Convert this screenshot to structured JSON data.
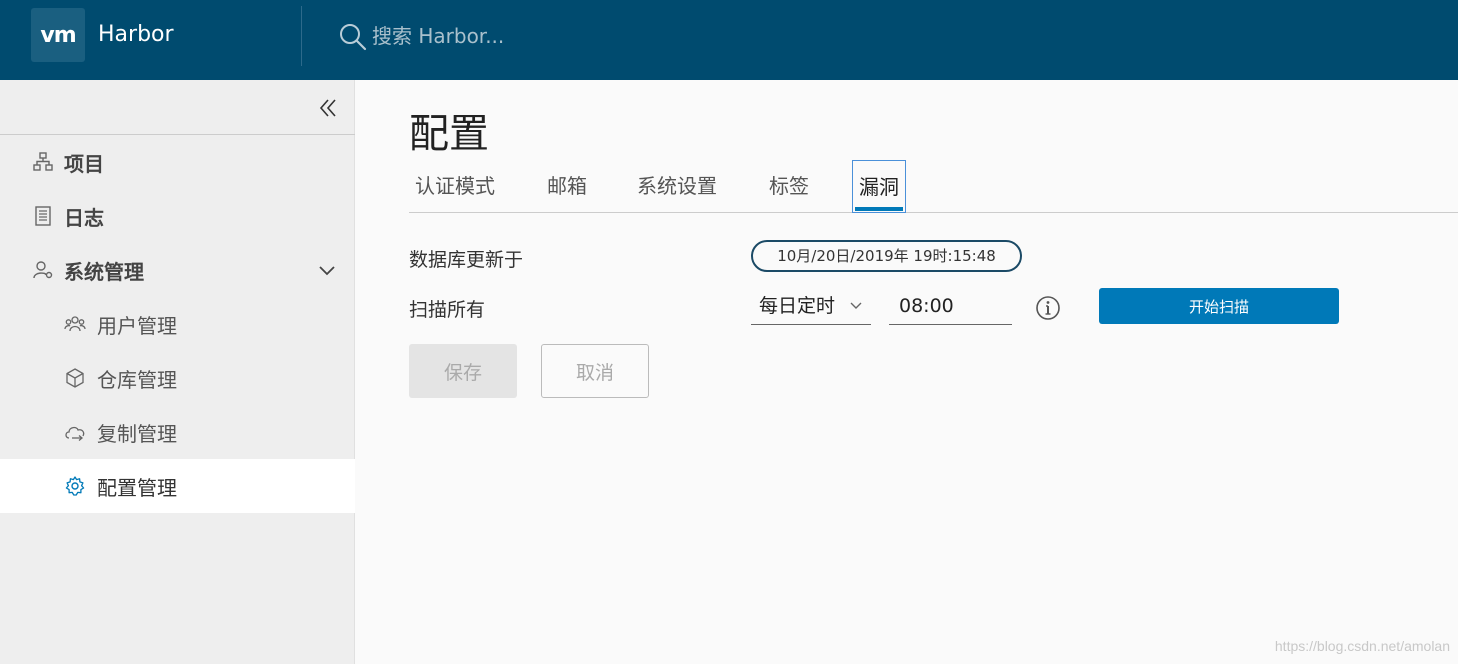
{
  "header": {
    "logo_text": "vm",
    "brand": "Harbor",
    "search_placeholder": "搜索 Harbor..."
  },
  "sidebar": {
    "items": [
      {
        "label": "项目",
        "icon": "project-icon"
      },
      {
        "label": "日志",
        "icon": "log-icon"
      },
      {
        "label": "系统管理",
        "icon": "admin-icon",
        "expanded": true
      },
      {
        "label": "用户管理",
        "icon": "users-icon"
      },
      {
        "label": "仓库管理",
        "icon": "registry-icon"
      },
      {
        "label": "复制管理",
        "icon": "replication-icon"
      },
      {
        "label": "配置管理",
        "icon": "gear-icon",
        "active": true
      }
    ]
  },
  "main": {
    "title": "配置",
    "tabs": [
      {
        "label": "认证模式"
      },
      {
        "label": "邮箱"
      },
      {
        "label": "系统设置"
      },
      {
        "label": "标签"
      },
      {
        "label": "漏洞",
        "active": true
      }
    ],
    "db_updated_label": "数据库更新于",
    "db_updated_value": "10月/20日/2019年 19时:15:48",
    "scan_all_label": "扫描所有",
    "schedule_value": "每日定时",
    "time_value": "08:00",
    "scan_button": "开始扫描",
    "save_button": "保存",
    "cancel_button": "取消"
  },
  "watermark": "https://blog.csdn.net/amolan",
  "colors": {
    "header_bg": "#004b6f",
    "primary": "#0079b8",
    "sidebar_bg": "#eeeeee"
  }
}
